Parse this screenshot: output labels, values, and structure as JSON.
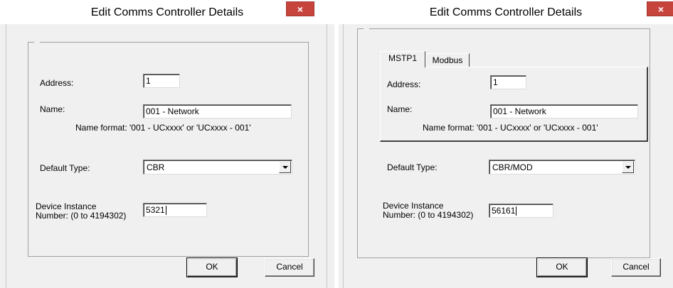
{
  "colors": {
    "close_bg": "#c7443d",
    "dialog_bg": "#f0f0f0"
  },
  "dialog_left": {
    "title": "Edit Comms Controller Details",
    "close_glyph": "×",
    "address_label": "Address:",
    "address_value": "1",
    "name_label": "Name:",
    "name_value": "001 - Network",
    "name_hint": "Name format: '001 - UCxxxx' or 'UCxxxx - 001'",
    "default_type_label": "Default Type:",
    "default_type_value": "CBR",
    "device_instance_label_line1": "Device Instance",
    "device_instance_label_line2": "Number: (0 to 4194302)",
    "device_instance_value": "5321",
    "ok_label": "OK",
    "cancel_label": "Cancel"
  },
  "dialog_right": {
    "title": "Edit Comms Controller Details",
    "close_glyph": "×",
    "tabs": [
      {
        "label": "MSTP1",
        "active": true
      },
      {
        "label": "Modbus",
        "active": false
      }
    ],
    "address_label": "Address:",
    "address_value": "1",
    "name_label": "Name:",
    "name_value": "001 - Network",
    "name_hint": "Name format: '001 - UCxxxx' or 'UCxxxx - 001'",
    "default_type_label": "Default Type:",
    "default_type_value": "CBR/MOD",
    "device_instance_label_line1": "Device Instance",
    "device_instance_label_line2": "Number: (0 to 4194302)",
    "device_instance_value": "56161",
    "ok_label": "OK",
    "cancel_label": "Cancel"
  }
}
